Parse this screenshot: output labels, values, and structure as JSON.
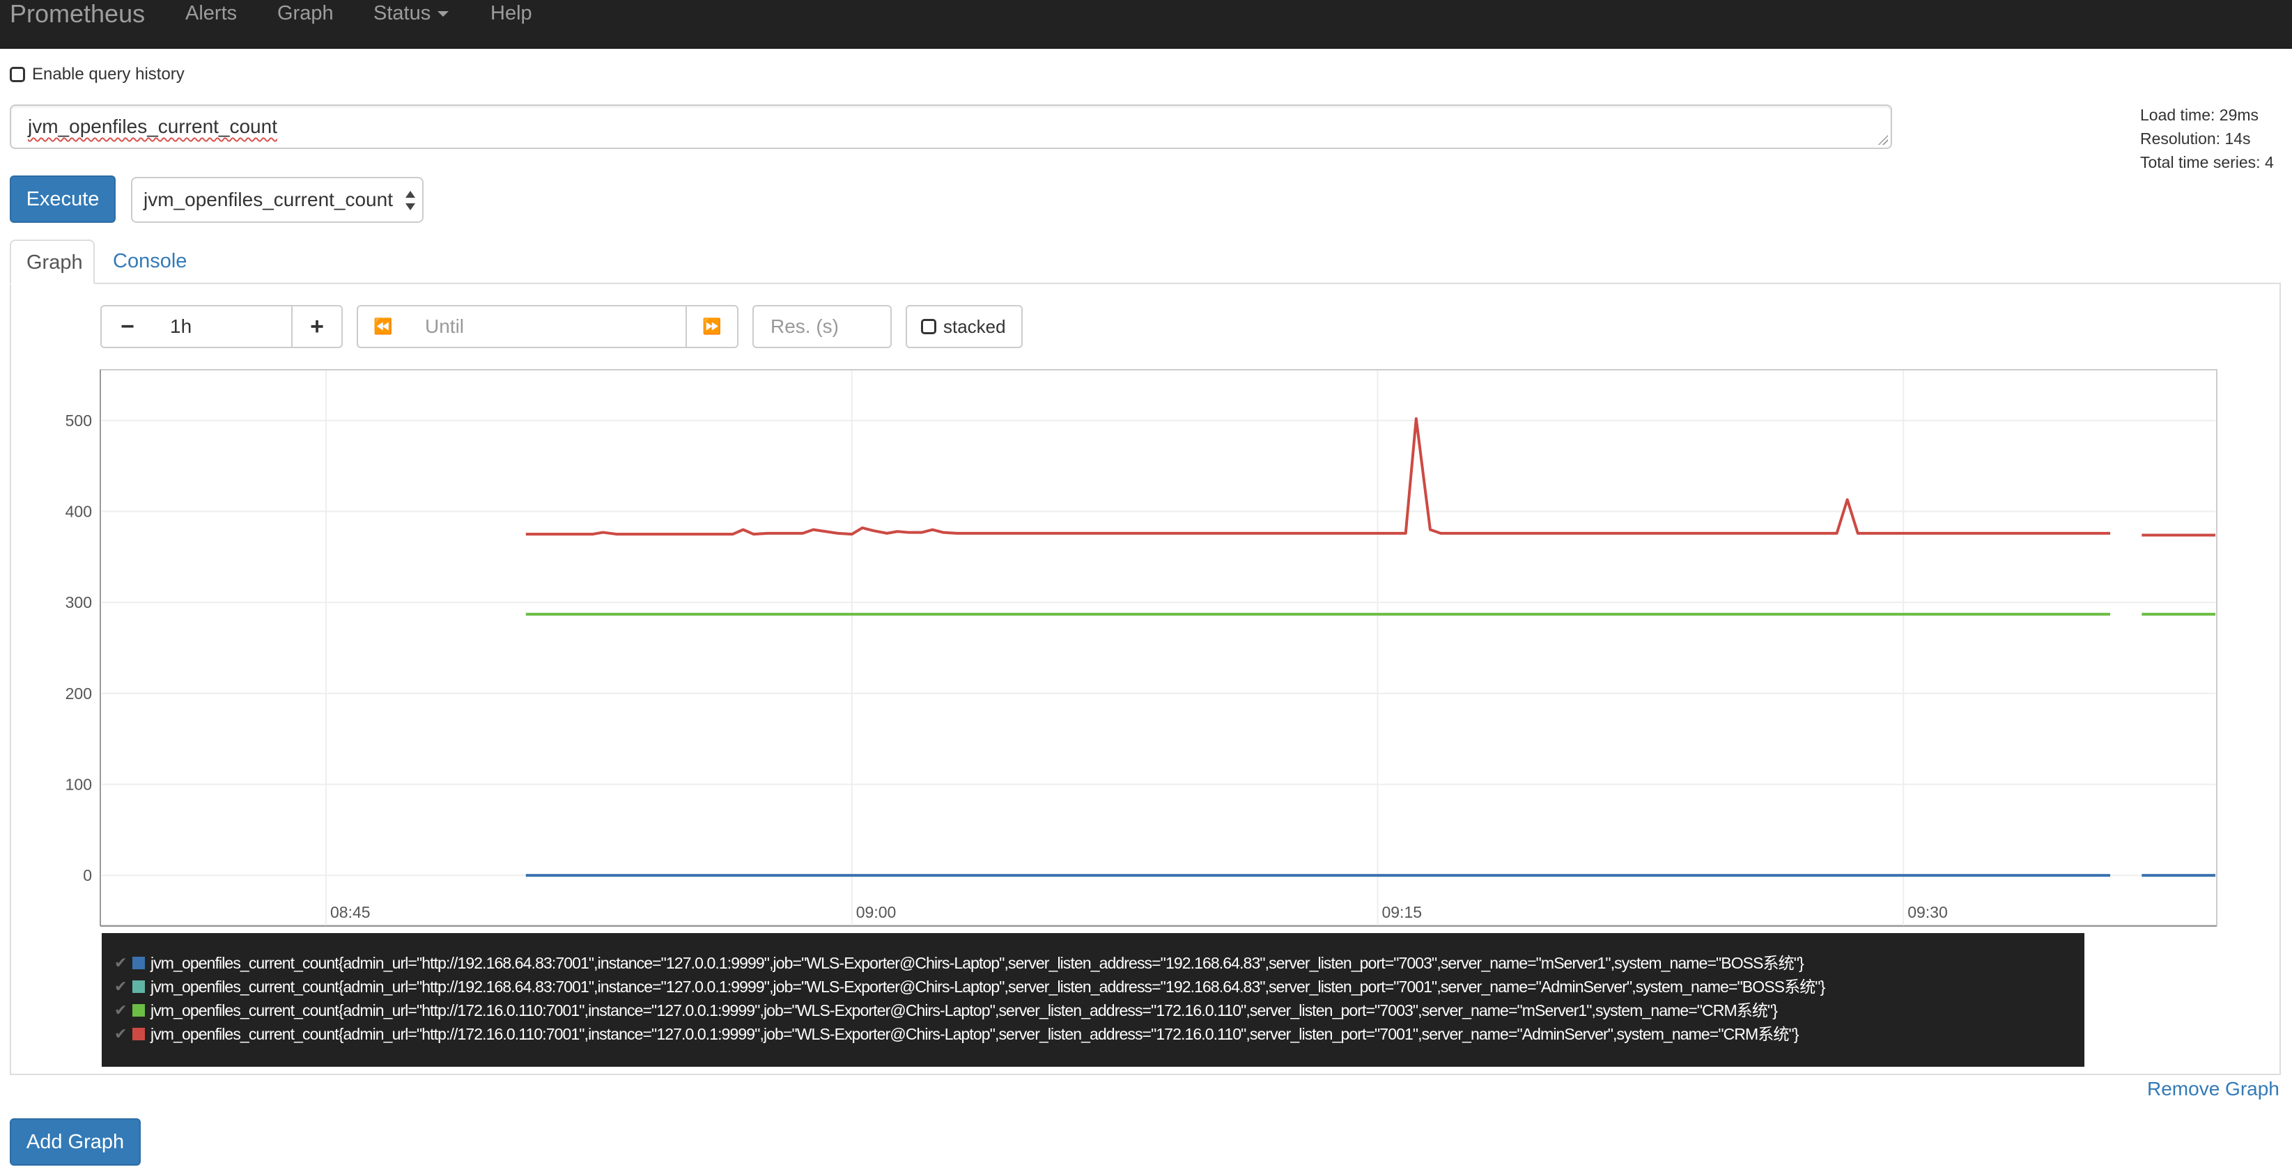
{
  "navbar": {
    "brand": "Prometheus",
    "items": [
      "Alerts",
      "Graph",
      "Status",
      "Help"
    ]
  },
  "query": {
    "history_label": "Enable query history",
    "expression": "jvm_openfiles_current_count",
    "execute_label": "Execute",
    "metric_select_value": "jvm_openfiles_current_count"
  },
  "stats": {
    "load_time": "Load time: 29ms",
    "resolution": "Resolution: 14s",
    "total_series": "Total time series: 4"
  },
  "tabs": [
    "Graph",
    "Console"
  ],
  "controls": {
    "range_decrease": "−",
    "range_value": "1h",
    "range_increase": "+",
    "back_icon": "⏪",
    "until_placeholder": "Until",
    "forward_icon": "⏩",
    "res_placeholder": "Res. (s)",
    "stacked_label": "stacked"
  },
  "chart_data": {
    "type": "line",
    "x_ticks": [
      "08:45",
      "09:00",
      "09:15",
      "09:30"
    ],
    "y_ticks": [
      "500",
      "400",
      "300",
      "200",
      "100",
      "0"
    ],
    "ylim": [
      -55,
      555
    ],
    "xlim_minutes": [
      38.6,
      98.9
    ],
    "gap_minutes": [
      95.9,
      96.8
    ],
    "grid": true,
    "series": [
      {
        "name": "jvm_openfiles_current_count{admin_url=\"http://192.168.64.83:7001\",instance=\"127.0.0.1:9999\",job=\"WLS-Exporter@Chirs-Laptop\",server_listen_address=\"192.168.64.83\",server_listen_port=\"7003\",server_name=\"mServer1\",system_name=\"BOSS系统\"}",
        "color": "#3a72b0",
        "points": [
          [
            50.7,
            0
          ],
          [
            95.9,
            0
          ],
          [
            96.8,
            0
          ],
          [
            98.9,
            0
          ]
        ]
      },
      {
        "name": "jvm_openfiles_current_count{admin_url=\"http://192.168.64.83:7001\",instance=\"127.0.0.1:9999\",job=\"WLS-Exporter@Chirs-Laptop\",server_listen_address=\"192.168.64.83\",server_listen_port=\"7001\",server_name=\"AdminServer\",system_name=\"BOSS系统\"}",
        "color": "#5fb4a6",
        "points": []
      },
      {
        "name": "jvm_openfiles_current_count{admin_url=\"http://172.16.0.110:7001\",instance=\"127.0.0.1:9999\",job=\"WLS-Exporter@Chirs-Laptop\",server_listen_address=\"172.16.0.110\",server_listen_port=\"7003\",server_name=\"mServer1\",system_name=\"CRM系统\"}",
        "color": "#6cbd45",
        "points": [
          [
            50.7,
            287
          ],
          [
            95.9,
            287
          ],
          [
            96.8,
            287
          ],
          [
            98.9,
            287
          ]
        ]
      },
      {
        "name": "jvm_openfiles_current_count{admin_url=\"http://172.16.0.110:7001\",instance=\"127.0.0.1:9999\",job=\"WLS-Exporter@Chirs-Laptop\",server_listen_address=\"172.16.0.110\",server_listen_port=\"7001\",server_name=\"AdminServer\",system_name=\"CRM系统\"}",
        "color": "#cc4a43",
        "points": [
          [
            50.7,
            375
          ],
          [
            52.6,
            375
          ],
          [
            52.9,
            377
          ],
          [
            53.3,
            375
          ],
          [
            56.6,
            375
          ],
          [
            56.9,
            380
          ],
          [
            57.2,
            375
          ],
          [
            57.6,
            376
          ],
          [
            58.6,
            376
          ],
          [
            58.9,
            380
          ],
          [
            59.6,
            376
          ],
          [
            60.0,
            375
          ],
          [
            60.3,
            382
          ],
          [
            60.6,
            379
          ],
          [
            61.0,
            376
          ],
          [
            61.3,
            378
          ],
          [
            61.6,
            377
          ],
          [
            62.0,
            377
          ],
          [
            62.3,
            380
          ],
          [
            62.6,
            377
          ],
          [
            63.0,
            376
          ],
          [
            75.8,
            376
          ],
          [
            76.1,
            502
          ],
          [
            76.5,
            380
          ],
          [
            76.8,
            376
          ],
          [
            88.1,
            376
          ],
          [
            88.4,
            413
          ],
          [
            88.7,
            376
          ],
          [
            95.9,
            376
          ],
          [
            96.8,
            374
          ],
          [
            98.9,
            374
          ]
        ]
      }
    ]
  },
  "footer": {
    "remove_graph": "Remove Graph",
    "add_graph": "Add Graph"
  }
}
